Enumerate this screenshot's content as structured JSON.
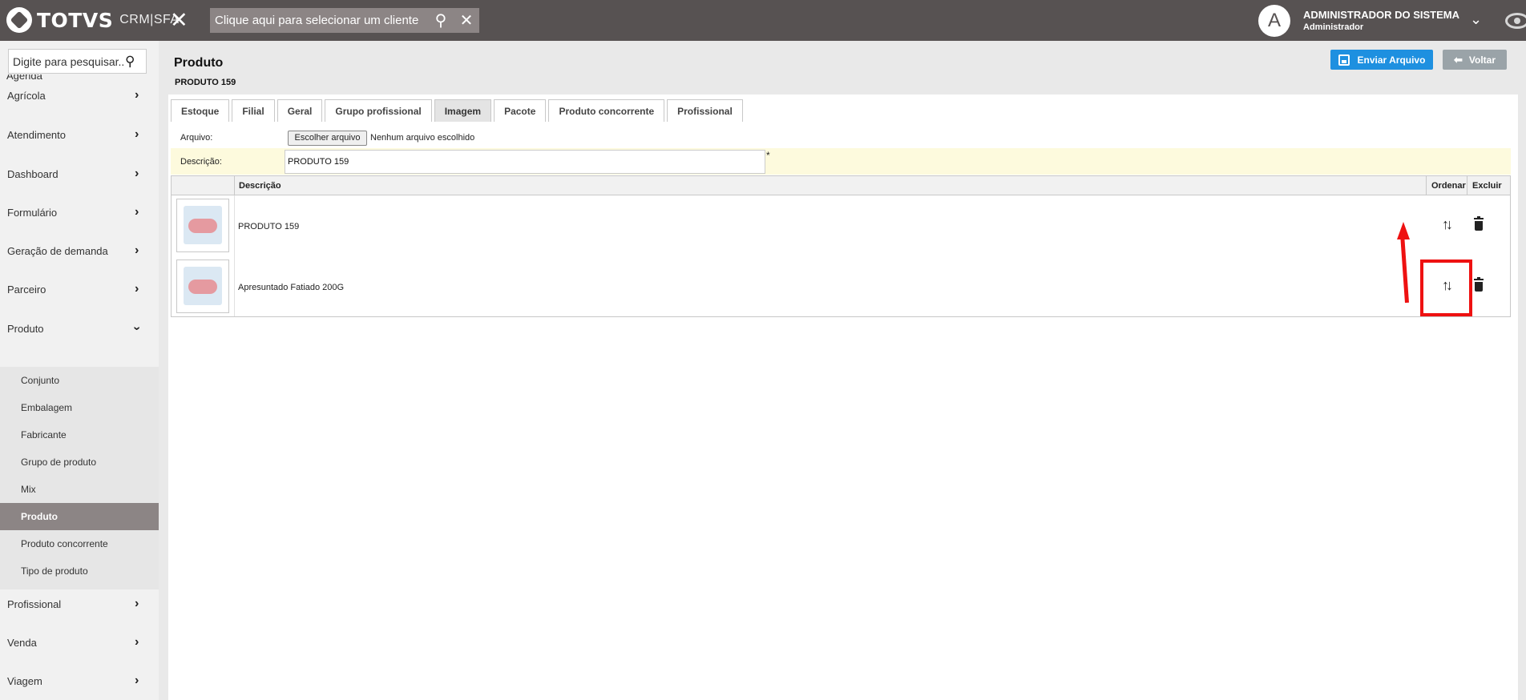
{
  "topbar": {
    "brand": "TOTVS",
    "brand_sub": "CRM|SFA",
    "client_placeholder": "Clique aqui para selecionar um cliente",
    "avatar_letter": "A",
    "user_name": "ADMINISTRADOR DO SISTEMA",
    "user_role": "Administrador"
  },
  "sidebar": {
    "search_placeholder": "Digite para pesquisar...",
    "cut_item": "Agenda",
    "items": [
      {
        "label": "Agrícola"
      },
      {
        "label": "Atendimento"
      },
      {
        "label": "Dashboard"
      },
      {
        "label": "Formulário"
      },
      {
        "label": "Geração de demanda"
      },
      {
        "label": "Parceiro"
      },
      {
        "label": "Produto"
      }
    ],
    "submenu": [
      {
        "label": "Conjunto"
      },
      {
        "label": "Embalagem"
      },
      {
        "label": "Fabricante"
      },
      {
        "label": "Grupo de produto"
      },
      {
        "label": "Mix"
      },
      {
        "label": "Produto"
      },
      {
        "label": "Produto concorrente"
      },
      {
        "label": "Tipo de produto"
      }
    ],
    "items_after": [
      {
        "label": "Profissional"
      },
      {
        "label": "Venda"
      },
      {
        "label": "Viagem"
      }
    ]
  },
  "page": {
    "title": "Produto",
    "subtitle": "PRODUTO 159",
    "send_button": "Enviar Arquivo",
    "back_button": "Voltar"
  },
  "tabs": [
    {
      "label": "Estoque"
    },
    {
      "label": "Filial"
    },
    {
      "label": "Geral"
    },
    {
      "label": "Grupo profissional"
    },
    {
      "label": "Imagem"
    },
    {
      "label": "Pacote"
    },
    {
      "label": "Produto concorrente"
    },
    {
      "label": "Profissional"
    }
  ],
  "form": {
    "file_label": "Arquivo:",
    "file_button": "Escolher arquivo",
    "file_none": "Nenhum arquivo escolhido",
    "desc_label": "Descrição:",
    "desc_value": "PRODUTO 159",
    "required_mark": "*"
  },
  "grid": {
    "columns": {
      "desc": "Descrição",
      "order": "Ordenar",
      "delete": "Excluir"
    },
    "rows": [
      {
        "desc": "PRODUTO 159"
      },
      {
        "desc": "Apresuntado Fatiado 200G"
      }
    ]
  },
  "colors": {
    "topbar": "#575252",
    "accent_blue": "#1e90e0",
    "annotation_red": "#ee1111"
  }
}
